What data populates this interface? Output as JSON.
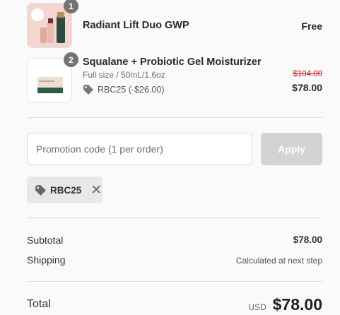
{
  "items": [
    {
      "qty": "1",
      "name": "Radiant Lift Duo GWP",
      "price": "Free",
      "image_alt": "radiant-lift-duo-product-image"
    },
    {
      "qty": "2",
      "name": "Squalane + Probiotic Gel Moisturizer",
      "variant": "Full size / 50mL/1.6oz",
      "discount_label": "RBC25 (-$26.00)",
      "original_price": "$104.00",
      "price": "$78.00",
      "image_alt": "moisturizer-jar-product-image"
    }
  ],
  "promo": {
    "placeholder": "Promotion code (1 per order)",
    "apply_label": "Apply",
    "applied_code": "RBC25"
  },
  "summary": {
    "subtotal_label": "Subtotal",
    "subtotal_value": "$78.00",
    "shipping_label": "Shipping",
    "shipping_value": "Calculated at next step",
    "total_label": "Total",
    "currency": "USD",
    "total_value": "$78.00"
  },
  "colors": {
    "strike_price": "#d32020",
    "apply_disabled": "#d3d3d3",
    "qty_badge": "#737373",
    "chip_bg": "#e8e8e8"
  },
  "icons": {
    "discount": "tag-icon",
    "remove": "close-icon"
  }
}
